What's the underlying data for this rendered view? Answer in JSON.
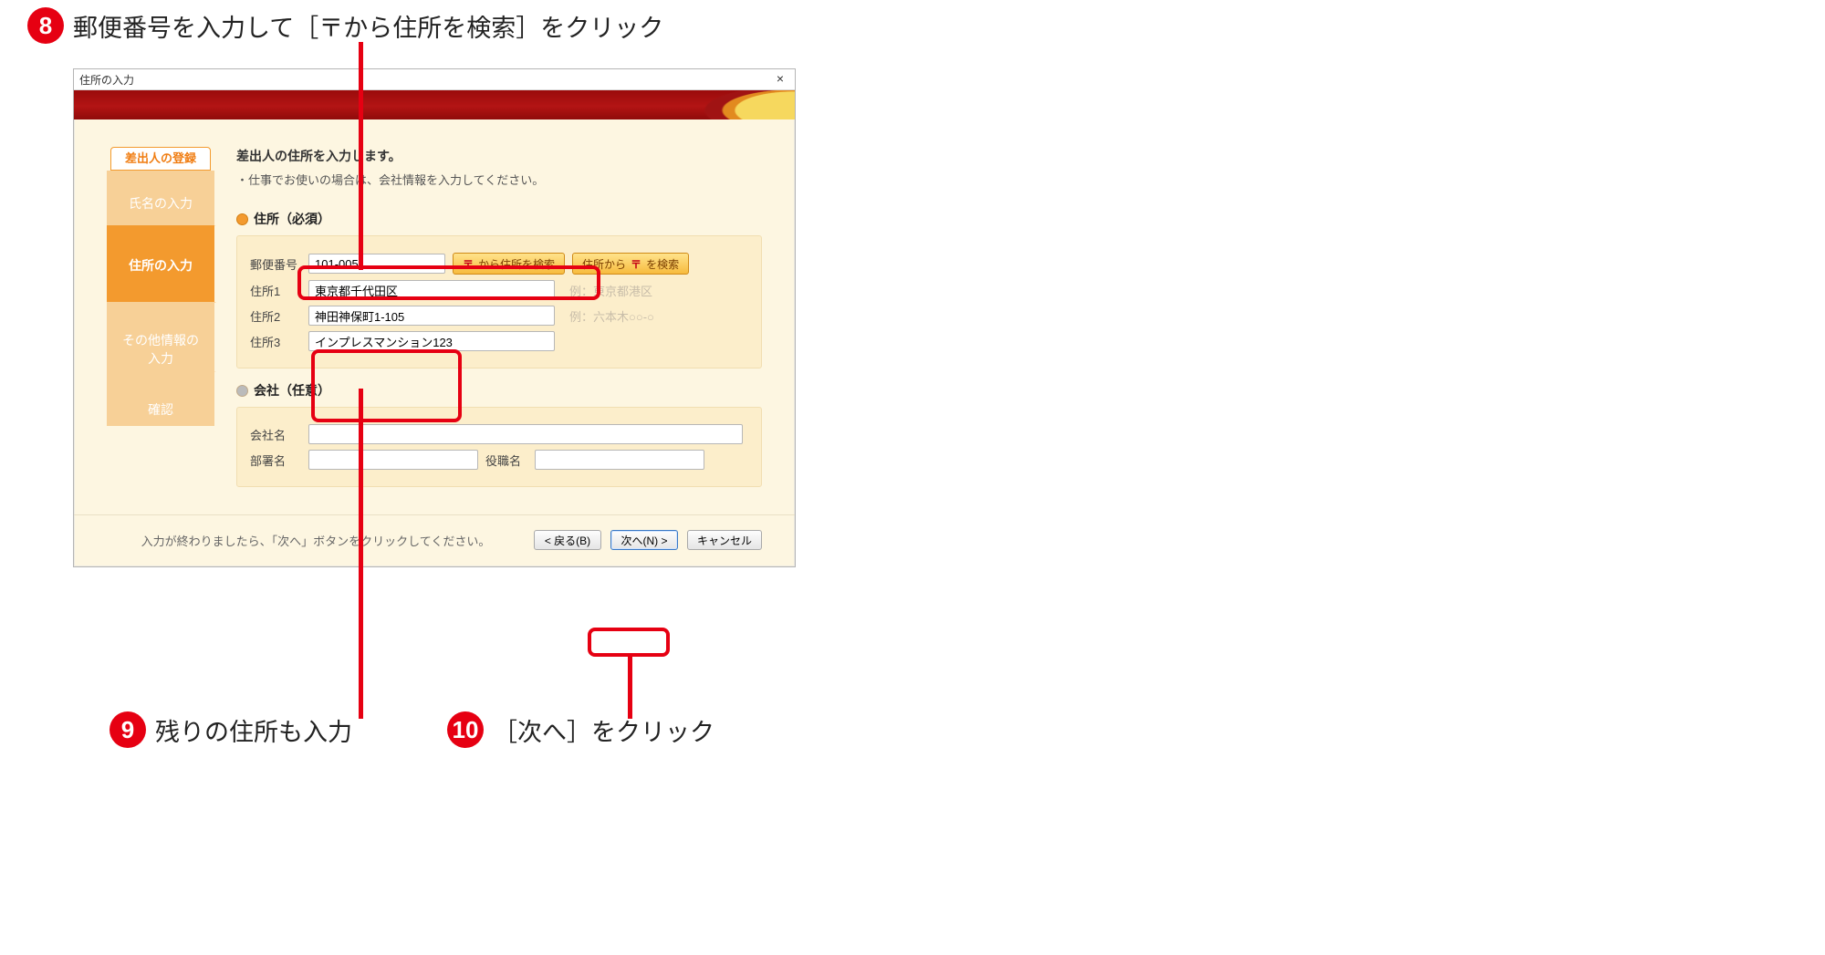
{
  "callouts": {
    "c8": {
      "num": "8",
      "text": "郵便番号を入力して［〒から住所を検索］をクリック"
    },
    "c9": {
      "num": "9",
      "text": "残りの住所も入力"
    },
    "c10": {
      "num": "10",
      "text": "［次へ］をクリック"
    }
  },
  "dialog": {
    "title": "住所の入力",
    "close": "×",
    "sidebar": {
      "header": "差出人の登録",
      "steps": {
        "name": "氏名の入力",
        "address": "住所の入力",
        "other": "その他情報の\n入力",
        "confirm": "確認"
      }
    },
    "main": {
      "heading": "差出人の住所を入力します。",
      "sub": "・仕事でお使いの場合は、会社情報を入力してください。",
      "section_address": "住所（必須）",
      "zip_label": "郵便番号",
      "zip_value": "101-0051",
      "btn_zip_to_addr": "から住所を検索",
      "btn_addr_to_zip_pre": "住所から",
      "btn_addr_to_zip_post": "を検索",
      "addr1_label": "住所1",
      "addr1_value": "東京都千代田区",
      "addr1_hint": "例：東京都港区",
      "addr2_label": "住所2",
      "addr2_value": "神田神保町1-105",
      "addr2_hint": "例：六本木○○-○",
      "addr3_label": "住所3",
      "addr3_value": "インプレスマンション123",
      "section_company": "会社（任意）",
      "company_label": "会社名",
      "dept_label": "部署名",
      "role_label": "役職名"
    },
    "footer": {
      "text": "入力が終わりましたら、「次へ」ボタンをクリックしてください。",
      "back": "< 戻る(B)",
      "next": "次へ(N) >",
      "cancel": "キャンセル"
    }
  }
}
